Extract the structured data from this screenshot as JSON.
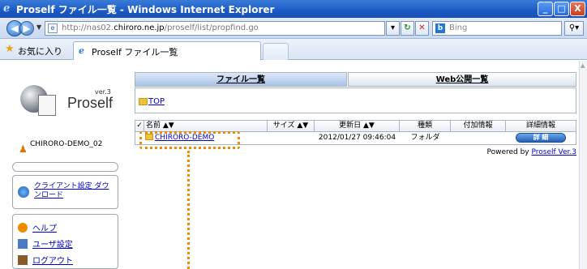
{
  "window": {
    "title": "Proself ファイル一覧 - Windows Internet Explorer",
    "min_label": "_",
    "max_label": "□",
    "close_label": "X"
  },
  "addressbar": {
    "url_prefix": "http://nas02.",
    "url_domain": "chiroro.ne.jp",
    "url_suffix": "/proself/list/propfind.go",
    "search_placeholder": "Bing",
    "search_engine_icon": "b"
  },
  "favorites": {
    "label": "お気に入り",
    "tab_title": "Proself ファイル一覧"
  },
  "sidebar": {
    "version": "ver.3",
    "logo": "Proself",
    "user_name": "CHIRORO-DEMO_02",
    "client_link": "クライアント設定 ダウンロード",
    "menu": [
      {
        "label": "ヘルプ",
        "icon": "help-icon"
      },
      {
        "label": "ユーザ設定",
        "icon": "user-settings-icon"
      },
      {
        "label": "ログアウト",
        "icon": "logout-icon"
      }
    ]
  },
  "main": {
    "tabs": [
      "ファイル一覧",
      "Web公開一覧"
    ],
    "path_link": "TOP",
    "table": {
      "headers": [
        "✓",
        "名前 ▲▼",
        "サイズ ▲▼",
        "更新日 ▲▼",
        "種類",
        "付加情報",
        "詳細情報"
      ],
      "rows": [
        {
          "name": "CHIRORO-DEMO",
          "size": "",
          "updated": "2012/01/27 09:46:04",
          "type": "フォルダ",
          "extra": "",
          "detail_button": "詳 細"
        }
      ]
    },
    "powered_prefix": "Powered by ",
    "powered_link": "Proself Ver.3"
  },
  "colors": {
    "titlebar": "#1c5ac4",
    "highlight": "#f08a00",
    "link": "#0000cc"
  }
}
